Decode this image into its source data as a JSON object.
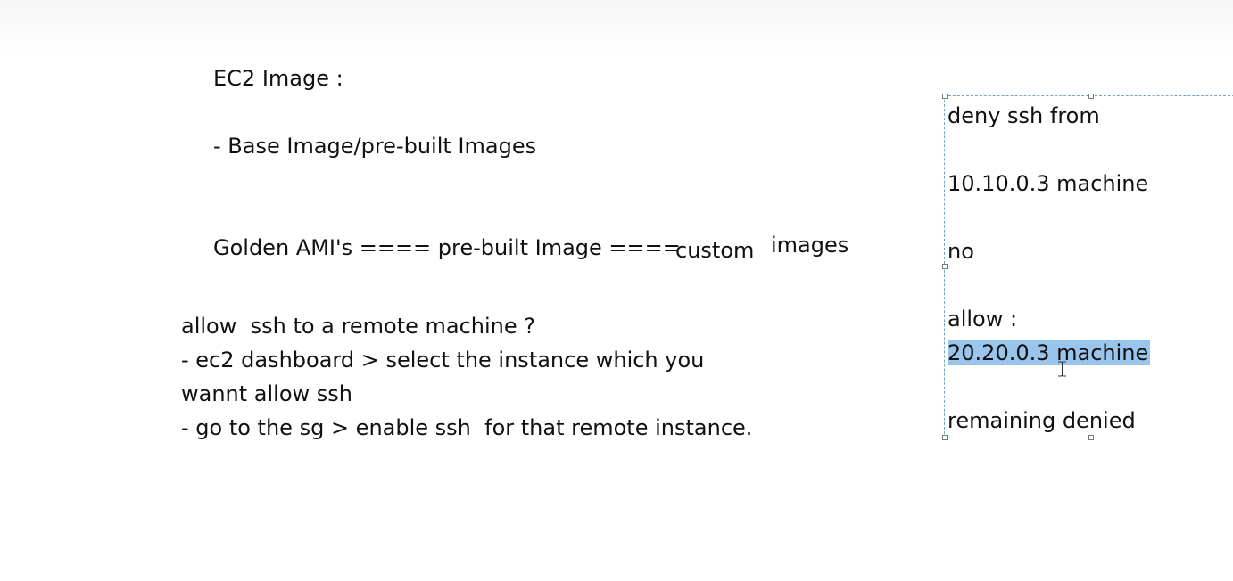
{
  "document": {
    "lines": {
      "title": "EC2 Image :",
      "base": "- Base Image/pre-built Images",
      "golden": "Golden AMI's ==== pre-built Image ====",
      "custom": "custom",
      "images": "images",
      "allow_question": "allow  ssh to a remote machine ?",
      "step1": "- ec2 dashboard > select the instance which you",
      "step1_cont": "wannt allow ssh",
      "step2": "- go to the sg > enable ssh  for that remote instance."
    }
  },
  "textbox": {
    "deny": "deny ssh from",
    "deny_ip": "10.10.0.3 machine",
    "no": "no",
    "allow": "allow :",
    "allow_ip_selected": "20.20.0.3 machine",
    "remaining": "remaining denied"
  },
  "colors": {
    "selection": "#99c4ec",
    "textbox_border": "#6fa6c7",
    "text": "#111111"
  },
  "icons": {
    "cursor": "i-beam-cursor-icon"
  }
}
